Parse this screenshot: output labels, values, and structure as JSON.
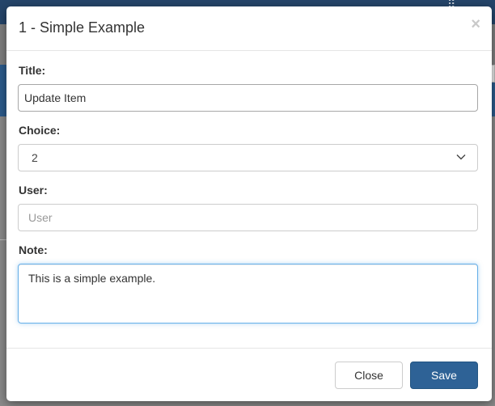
{
  "modal": {
    "title": "1 - Simple Example",
    "close_symbol": "×",
    "fields": {
      "title": {
        "label": "Title:",
        "value": "Update Item"
      },
      "choice": {
        "label": "Choice:",
        "value": "2"
      },
      "user": {
        "label": "User:",
        "value": "",
        "placeholder": "User"
      },
      "note": {
        "label": "Note:",
        "value": "This is a simple example."
      }
    },
    "buttons": {
      "close_label": "Close",
      "save_label": "Save"
    }
  },
  "icons": {
    "dialog_close": "close-icon",
    "select_arrow": "chevron-down-icon",
    "background_menu": "grid-icon"
  },
  "colors": {
    "primary": "#2e6296",
    "focus_border": "#66afe9",
    "header_background": "#25456a"
  }
}
